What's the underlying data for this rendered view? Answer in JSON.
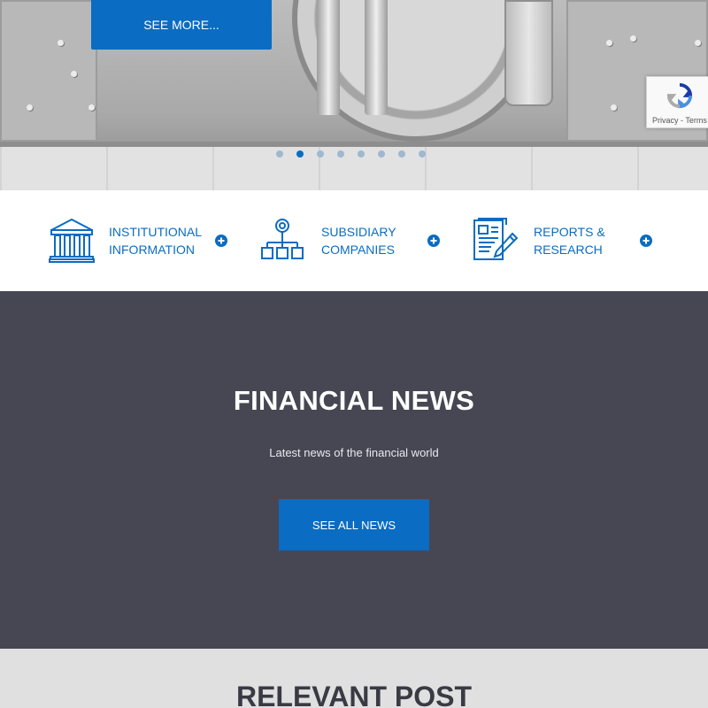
{
  "hero": {
    "see_more_label": "SEE MORE...",
    "slide_count": 8,
    "active_slide": 2
  },
  "recaptcha": {
    "links_text": "Privacy - Terms"
  },
  "features": [
    {
      "line1": "INSTITUTIONAL",
      "line2": "INFORMATION",
      "icon": "bank-building-icon"
    },
    {
      "line1": "SUBSIDIARY",
      "line2": "COMPANIES",
      "icon": "org-chart-icon"
    },
    {
      "line1": "REPORTS &",
      "line2": "RESEARCH",
      "icon": "report-document-icon"
    }
  ],
  "news": {
    "title": "FINANCIAL NEWS",
    "subtitle": "Latest news of the financial world",
    "button_label": "SEE ALL NEWS"
  },
  "relevant": {
    "title": "RELEVANT POST"
  },
  "colors": {
    "accent": "#0a6cc2",
    "news_bg": "#474753",
    "relevant_bg": "#e0e0e0"
  }
}
